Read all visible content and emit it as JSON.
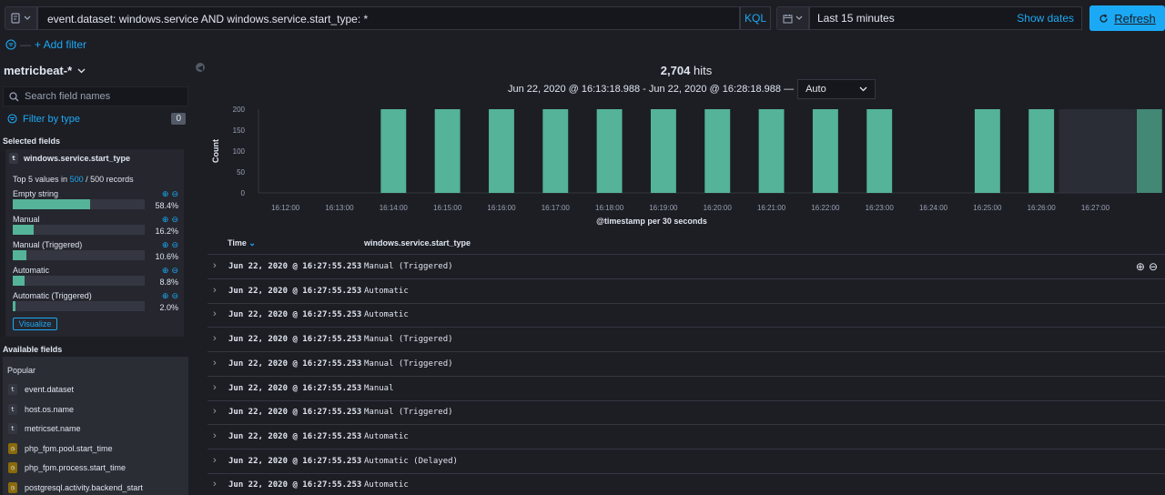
{
  "query": {
    "text": "event.dataset: windows.service AND windows.service.start_type: *",
    "language": "KQL"
  },
  "time": {
    "label": "Last 15 minutes",
    "show_dates": "Show dates",
    "refresh": "Refresh"
  },
  "filters": {
    "add_filter": "+ Add filter"
  },
  "sidebar": {
    "index_pattern": "metricbeat-*",
    "search_placeholder": "Search field names",
    "filter_by_type": "Filter by type",
    "filter_count": "0",
    "selected_title": "Selected fields",
    "selected_field": "windows.service.start_type",
    "selected_field_type": "t",
    "top5_prefix": "Top 5 values in",
    "top5_sample": "500",
    "top5_suffix": "/ 500 records",
    "top_values": [
      {
        "label": "Empty string",
        "pct": "58.4%",
        "fraction": 0.584
      },
      {
        "label": "Manual",
        "pct": "16.2%",
        "fraction": 0.162
      },
      {
        "label": "Manual (Triggered)",
        "pct": "10.6%",
        "fraction": 0.106
      },
      {
        "label": "Automatic",
        "pct": "8.8%",
        "fraction": 0.088
      },
      {
        "label": "Automatic (Triggered)",
        "pct": "2.0%",
        "fraction": 0.02
      }
    ],
    "visualize": "Visualize",
    "available_title": "Available fields",
    "popular_title": "Popular",
    "available_fields": [
      {
        "name": "event.dataset",
        "type": "t"
      },
      {
        "name": "host.os.name",
        "type": "t"
      },
      {
        "name": "metricset.name",
        "type": "t"
      },
      {
        "name": "php_fpm.pool.start_time",
        "type": "date"
      },
      {
        "name": "php_fpm.process.start_time",
        "type": "date"
      },
      {
        "name": "postgresql.activity.backend_start",
        "type": "date"
      }
    ]
  },
  "histogram": {
    "hits": "2,704",
    "hits_label": "hits",
    "range": "Jun 22, 2020 @ 16:13:18.988 - Jun 22, 2020 @ 16:28:18.988 —",
    "interval": "Auto"
  },
  "chart_data": {
    "type": "bar",
    "ylabel": "Count",
    "xlabel": "@timestamp per 30 seconds",
    "ylim": [
      0,
      200
    ],
    "y_ticks": [
      "200",
      "150",
      "100",
      "50",
      "0"
    ],
    "x_ticks": [
      "16:12:00",
      "16:13:00",
      "16:14:00",
      "16:15:00",
      "16:16:00",
      "16:17:00",
      "16:18:00",
      "16:19:00",
      "16:20:00",
      "16:21:00",
      "16:22:00",
      "16:23:00",
      "16:24:00",
      "16:25:00",
      "16:26:00",
      "16:27:00"
    ],
    "bars": [
      {
        "time": "16:14:00",
        "value": 208
      },
      {
        "time": "16:15:00",
        "value": 208
      },
      {
        "time": "16:16:00",
        "value": 208
      },
      {
        "time": "16:17:00",
        "value": 208
      },
      {
        "time": "16:18:00",
        "value": 208
      },
      {
        "time": "16:19:00",
        "value": 208
      },
      {
        "time": "16:20:00",
        "value": 208
      },
      {
        "time": "16:21:00",
        "value": 208
      },
      {
        "time": "16:22:00",
        "value": 208
      },
      {
        "time": "16:23:00",
        "value": 208
      },
      {
        "time": "16:25:00",
        "value": 208
      },
      {
        "time": "16:26:00",
        "value": 208
      },
      {
        "time": "16:28:00",
        "value": 208
      }
    ],
    "bar_color": "#54b399",
    "grid": false
  },
  "table": {
    "col_time": "Time",
    "col_field": "windows.service.start_type",
    "rows": [
      {
        "time": "Jun 22, 2020 @ 16:27:55.253",
        "value": "Manual (Triggered)"
      },
      {
        "time": "Jun 22, 2020 @ 16:27:55.253",
        "value": "Automatic"
      },
      {
        "time": "Jun 22, 2020 @ 16:27:55.253",
        "value": "Automatic"
      },
      {
        "time": "Jun 22, 2020 @ 16:27:55.253",
        "value": "Manual (Triggered)"
      },
      {
        "time": "Jun 22, 2020 @ 16:27:55.253",
        "value": "Manual (Triggered)"
      },
      {
        "time": "Jun 22, 2020 @ 16:27:55.253",
        "value": "Manual"
      },
      {
        "time": "Jun 22, 2020 @ 16:27:55.253",
        "value": "Manual (Triggered)"
      },
      {
        "time": "Jun 22, 2020 @ 16:27:55.253",
        "value": "Automatic"
      },
      {
        "time": "Jun 22, 2020 @ 16:27:55.253",
        "value": "Automatic (Delayed)"
      },
      {
        "time": "Jun 22, 2020 @ 16:27:55.253",
        "value": "Automatic"
      }
    ]
  }
}
